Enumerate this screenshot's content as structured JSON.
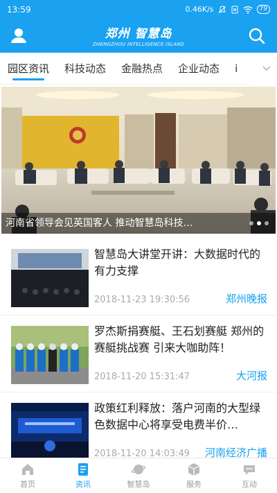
{
  "status": {
    "time": "13:59",
    "speed": "0.46K/s",
    "battery": "79"
  },
  "header": {
    "title": "郑州 智慧岛",
    "subtitle": "ZHENGZHOU INTELLIGENCE ISLAND"
  },
  "tabs": [
    {
      "label": "园区资讯",
      "active": true
    },
    {
      "label": "科技动态"
    },
    {
      "label": "金融热点"
    },
    {
      "label": "企业动态"
    },
    {
      "label": "i"
    }
  ],
  "banner": {
    "caption": "河南省领导会见英国客人 推动智慧岛科技…",
    "dots": 3,
    "active_dot": 1
  },
  "news": [
    {
      "title": "智慧岛大讲堂开讲：大数据时代的有力支撑",
      "date": "2018-11-23 19:30:56",
      "source": "郑州晚报"
    },
    {
      "title": "罗杰斯捐赛艇、王石划赛艇 郑州的赛艇挑战赛 引来大咖助阵！",
      "date": "2018-11-20 15:31:47",
      "source": "大河报"
    },
    {
      "title": "政策红利释放：落户河南的大型绿色数据中心将享受电费半价…",
      "date": "2018-11-20 14:03:49",
      "source": "河南经济广播"
    }
  ],
  "bottom_nav": [
    {
      "label": "首页",
      "icon": "home-icon"
    },
    {
      "label": "资讯",
      "icon": "news-icon",
      "active": true
    },
    {
      "label": "智慧岛",
      "icon": "planet-icon"
    },
    {
      "label": "服务",
      "icon": "cube-icon"
    },
    {
      "label": "互动",
      "icon": "chat-icon"
    }
  ],
  "colors": {
    "accent": "#1aa1f0"
  }
}
